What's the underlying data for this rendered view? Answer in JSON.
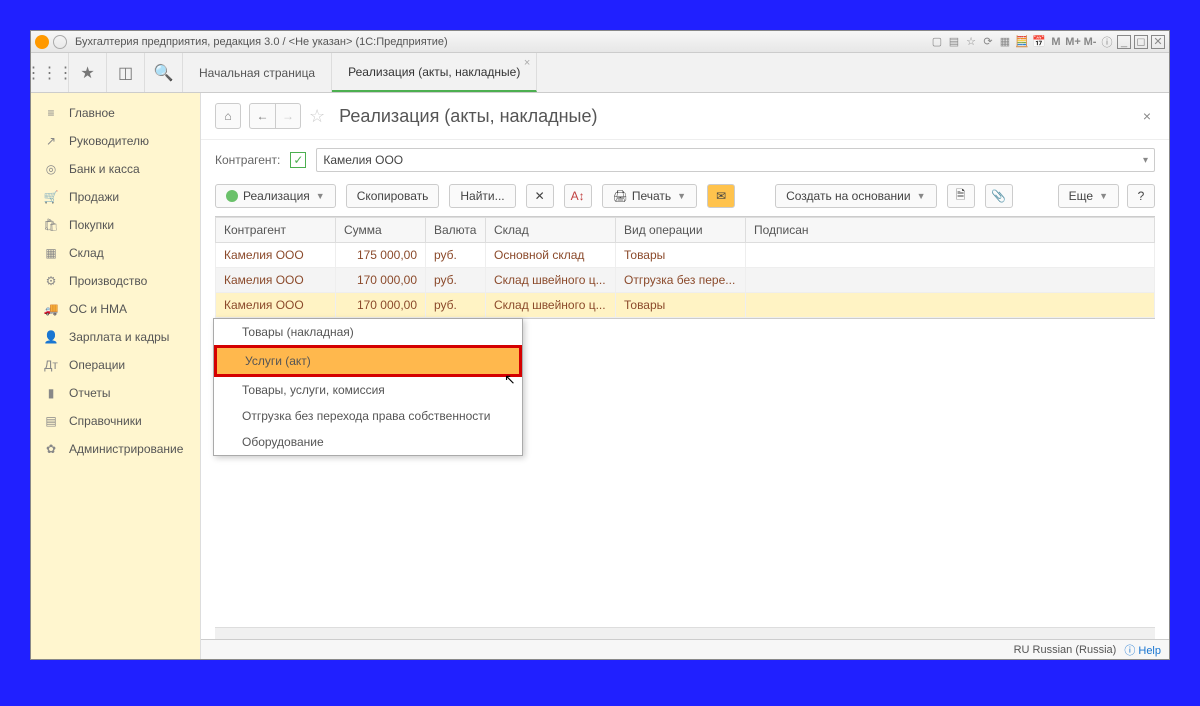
{
  "title": "Бухгалтерия предприятия, редакция 3.0 / <Не указан>  (1С:Предприятие)",
  "tb_marks": [
    "М",
    "М+",
    "М-"
  ],
  "tabs": {
    "home": "Начальная страница",
    "active": "Реализация (акты, накладные)"
  },
  "sidebar": [
    {
      "icon": "≡",
      "label": "Главное"
    },
    {
      "icon": "↗",
      "label": "Руководителю"
    },
    {
      "icon": "◎",
      "label": "Банк и касса"
    },
    {
      "icon": "🛒",
      "label": "Продажи"
    },
    {
      "icon": "🛍",
      "label": "Покупки"
    },
    {
      "icon": "▦",
      "label": "Склад"
    },
    {
      "icon": "⚙",
      "label": "Производство"
    },
    {
      "icon": "🚚",
      "label": "ОС и НМА"
    },
    {
      "icon": "👤",
      "label": "Зарплата и кадры"
    },
    {
      "icon": "Дт",
      "label": "Операции"
    },
    {
      "icon": "▮",
      "label": "Отчеты"
    },
    {
      "icon": "▤",
      "label": "Справочники"
    },
    {
      "icon": "✿",
      "label": "Администрирование"
    }
  ],
  "page_title": "Реализация (акты, накладные)",
  "filter": {
    "label": "Контрагент:",
    "value": "Камелия ООО"
  },
  "actions": {
    "realize": "Реализация",
    "copy": "Скопировать",
    "find": "Найти...",
    "print": "Печать",
    "create_on": "Создать на основании",
    "more": "Еще",
    "help": "?"
  },
  "dropdown": [
    "Товары (накладная)",
    "Услуги (акт)",
    "Товары, услуги, комиссия",
    "Отгрузка без перехода права собственности",
    "Оборудование"
  ],
  "grid": {
    "headers": [
      "Контрагент",
      "Сумма",
      "Валюта",
      "Склад",
      "Вид операции",
      "Подписан"
    ],
    "rows": [
      {
        "kp": "Камелия ООО",
        "sum": "175 000,00",
        "val": "руб.",
        "skl": "Основной склад",
        "op": "Товары"
      },
      {
        "kp": "Камелия ООО",
        "sum": "170 000,00",
        "val": "руб.",
        "skl": "Склад швейного ц...",
        "op": "Отгрузка без пере..."
      },
      {
        "kp": "Камелия ООО",
        "sum": "170 000,00",
        "val": "руб.",
        "skl": "Склад швейного ц...",
        "op": "Товары"
      }
    ]
  },
  "status": {
    "lang": "RU Russian (Russia)",
    "help": "Help"
  }
}
